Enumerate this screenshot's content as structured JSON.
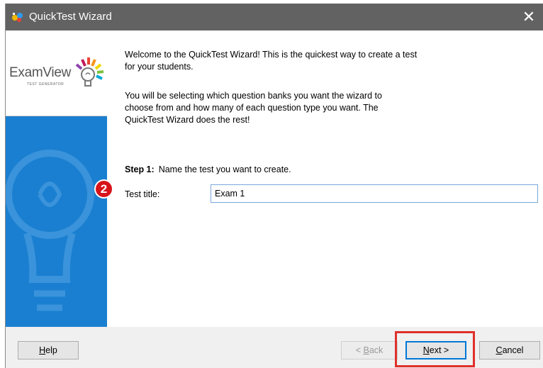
{
  "window": {
    "title": "QuickTest Wizard",
    "close_glyph": "✕"
  },
  "logo": {
    "name": "ExamView",
    "subtitle": "TEST GENERATOR"
  },
  "intro": {
    "line1": "Welcome to the QuickTest Wizard!  This is the quickest way to create a test",
    "line2": "for your students.",
    "line3": "You will be selecting which question banks you want the wizard to",
    "line4": "choose from and how many of each question type you want.  The",
    "line5": "QuickTest Wizard does the rest!"
  },
  "step": {
    "number": "Step 1:",
    "text": "Name the test you want to create."
  },
  "form": {
    "label": "Test title:",
    "value": "Exam 1"
  },
  "annotation": {
    "badge": "2"
  },
  "buttons": {
    "help": {
      "mnemonic": "H",
      "rest": "elp"
    },
    "back": {
      "prefix": "< ",
      "mnemonic": "B",
      "rest": "ack"
    },
    "next": {
      "mnemonic": "N",
      "rest": "ext >"
    },
    "cancel": {
      "mnemonic": "C",
      "rest": "ancel"
    }
  },
  "colors": {
    "titlebar": "#626262",
    "sidebar": "#1a7fd0",
    "badge": "#d7141a",
    "highlight": "#e0302b",
    "default_button_border": "#0078d7"
  },
  "icons": {
    "app": "quicktest-app-icon",
    "logo": "lightbulb-icon",
    "close": "close-icon"
  }
}
